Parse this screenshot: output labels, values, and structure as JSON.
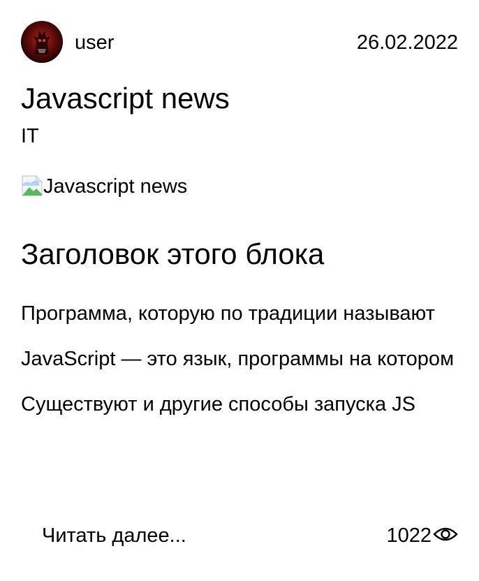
{
  "post": {
    "author": "user",
    "date": "26.02.2022",
    "title": "Javascript news",
    "category": "IT",
    "image_alt": "Javascript news",
    "block_title": "Заголовок этого блока",
    "paragraphs": [
      "Программа, которую по традиции называют",
      "JavaScript — это язык, программы на котором",
      "Существуют и другие способы запуска JS"
    ],
    "read_more_label": "Читать далее...",
    "views": "1022"
  },
  "icons": {
    "avatar": "avatar-image",
    "broken_image": "broken-image-icon",
    "views": "eye-icon"
  },
  "colors": {
    "text": "#000000",
    "background": "#ffffff",
    "avatar_red": "#a01818"
  }
}
